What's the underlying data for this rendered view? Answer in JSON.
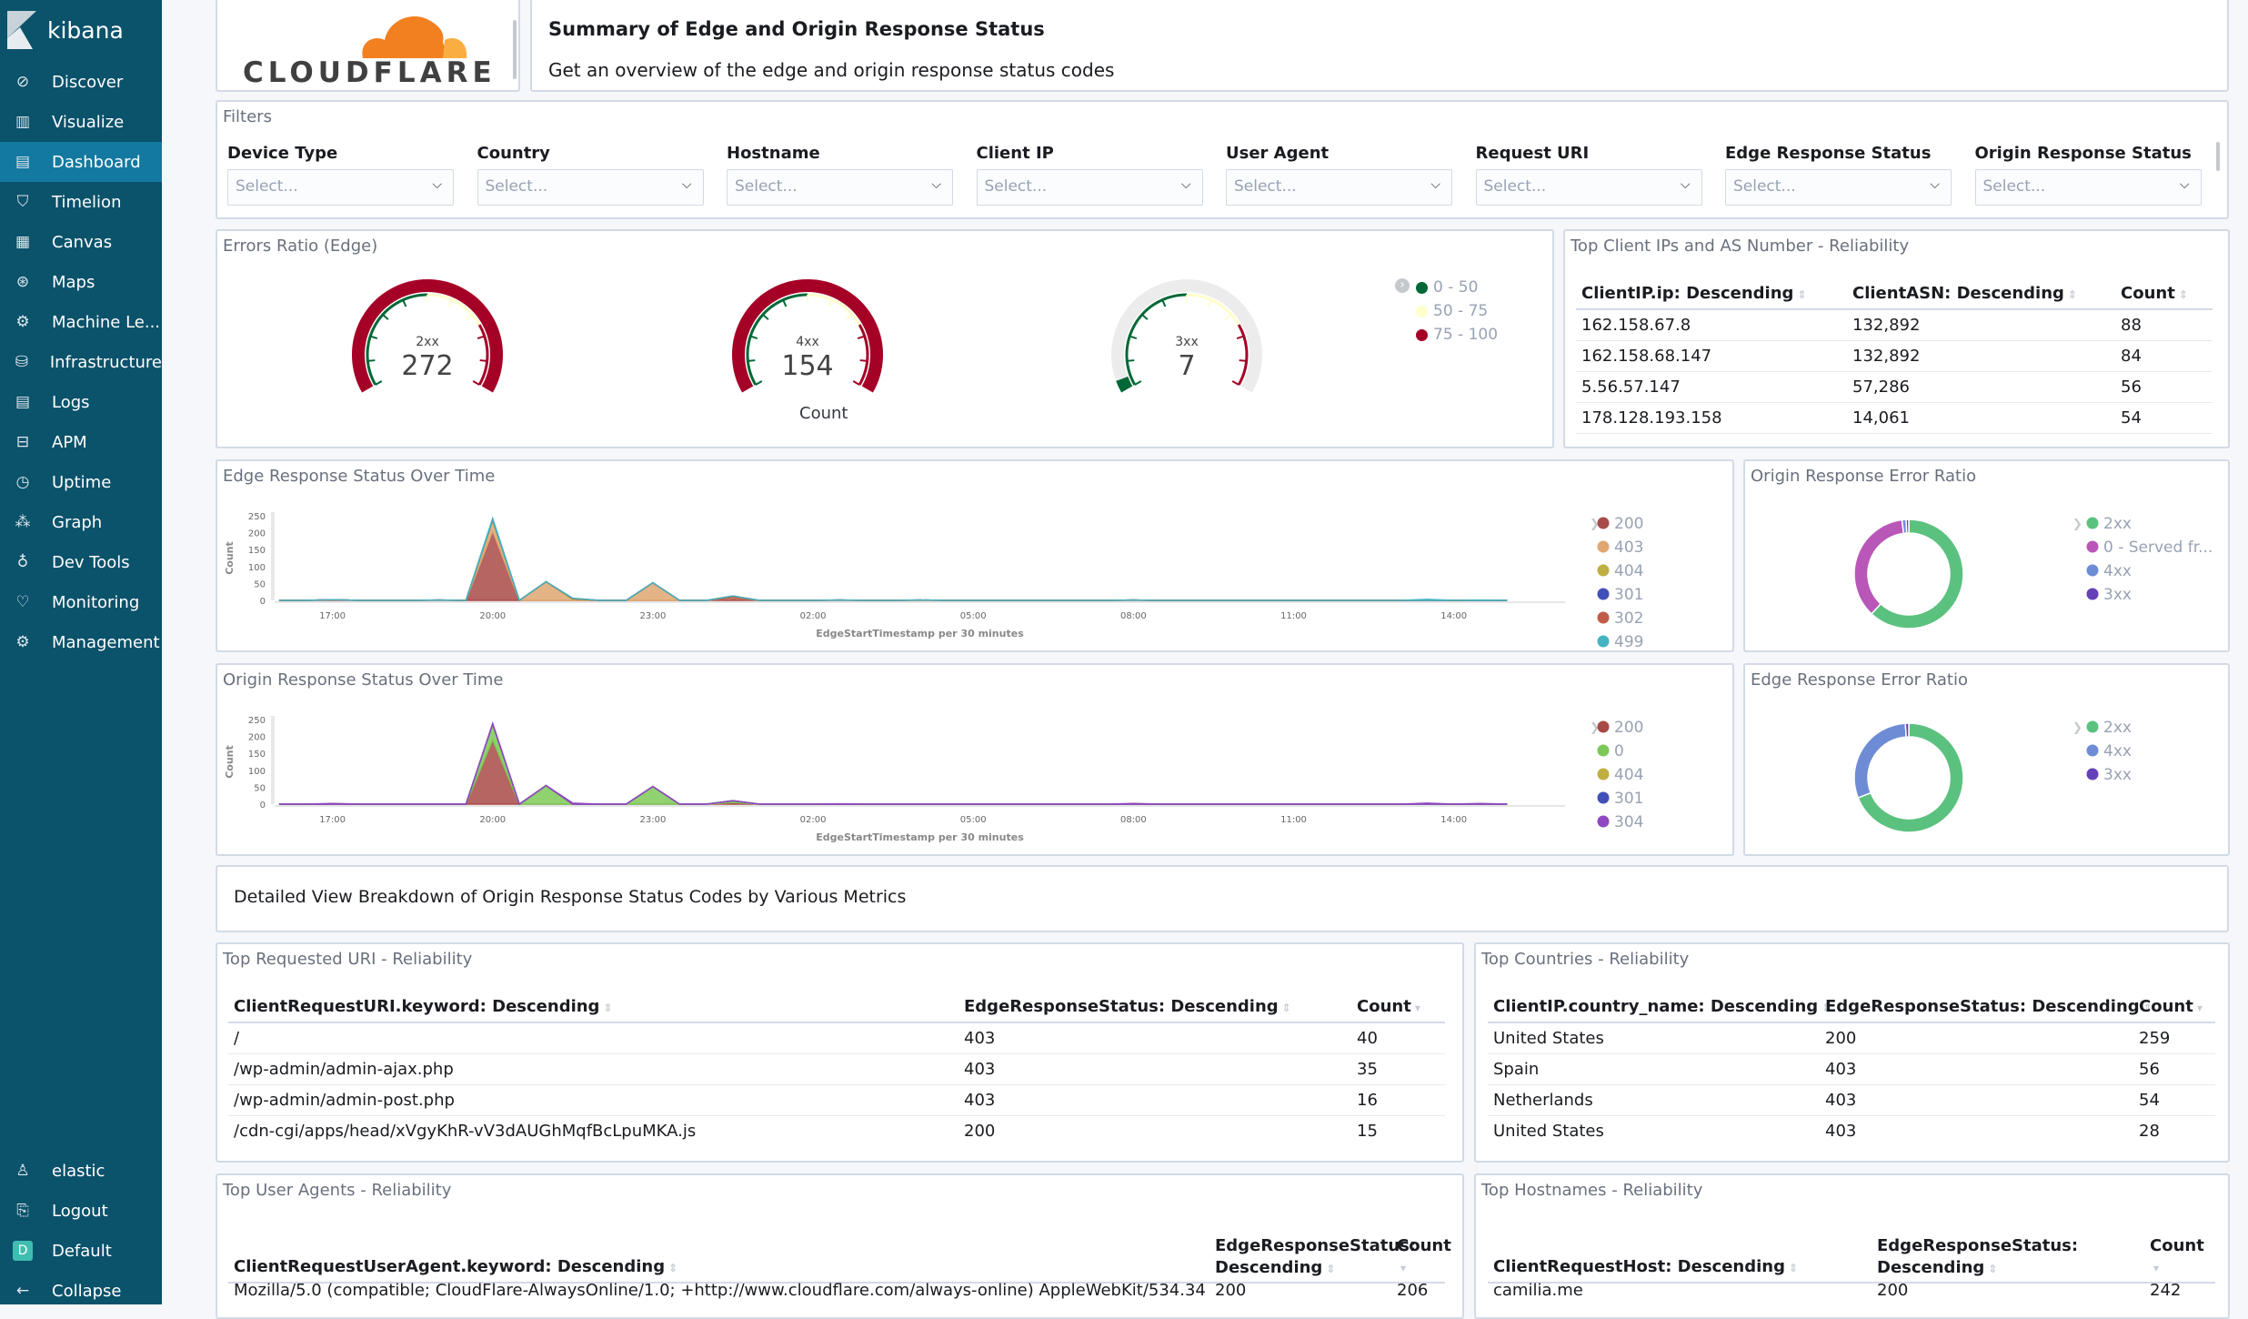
{
  "sidebar": {
    "brand": "kibana",
    "items": [
      {
        "label": "Discover",
        "icon": "compass-icon",
        "glyph": "⊘"
      },
      {
        "label": "Visualize",
        "icon": "visualize-icon",
        "glyph": "▥"
      },
      {
        "label": "Dashboard",
        "icon": "dashboard-icon",
        "glyph": "▤",
        "active": true
      },
      {
        "label": "Timelion",
        "icon": "timelion-icon",
        "glyph": "⛉"
      },
      {
        "label": "Canvas",
        "icon": "canvas-icon",
        "glyph": "▦"
      },
      {
        "label": "Maps",
        "icon": "maps-icon",
        "glyph": "⊛"
      },
      {
        "label": "Machine Le...",
        "icon": "machine-learning-icon",
        "glyph": "⚙"
      },
      {
        "label": "Infrastructure",
        "icon": "infrastructure-icon",
        "glyph": "⛁"
      },
      {
        "label": "Logs",
        "icon": "logs-icon",
        "glyph": "▤"
      },
      {
        "label": "APM",
        "icon": "apm-icon",
        "glyph": "⊟"
      },
      {
        "label": "Uptime",
        "icon": "uptime-icon",
        "glyph": "◷"
      },
      {
        "label": "Graph",
        "icon": "graph-icon",
        "glyph": "⁂"
      },
      {
        "label": "Dev Tools",
        "icon": "dev-tools-icon",
        "glyph": "♁"
      },
      {
        "label": "Monitoring",
        "icon": "monitoring-icon",
        "glyph": "♡"
      },
      {
        "label": "Management",
        "icon": "gear-icon",
        "glyph": "⚙"
      }
    ],
    "bottom": [
      {
        "label": "elastic",
        "icon": "user-icon",
        "glyph": "♙"
      },
      {
        "label": "Logout",
        "icon": "logout-icon",
        "glyph": "⎘"
      },
      {
        "label": "Default",
        "icon": "space-icon",
        "glyph": "D"
      },
      {
        "label": "Collapse",
        "icon": "collapse-icon",
        "glyph": "←"
      }
    ]
  },
  "header": {
    "logo_text": "CLOUDFLARE",
    "title": "Summary of Edge and Origin Response Status",
    "subtitle": "Get an overview of the edge and origin response status codes"
  },
  "filters": {
    "title": "Filters",
    "placeholder": "Select...",
    "controls": [
      "Device Type",
      "Country",
      "Hostname",
      "Client IP",
      "User Agent",
      "Request URI",
      "Edge Response Status",
      "Origin Response Status"
    ]
  },
  "gauges": {
    "title": "Errors Ratio (Edge)",
    "metric_label": "Count",
    "items": [
      {
        "label": "2xx",
        "value": "272",
        "fill_percent": 100
      },
      {
        "label": "4xx",
        "value": "154",
        "fill_percent": 100
      },
      {
        "label": "3xx",
        "value": "7",
        "fill_percent": 4
      }
    ],
    "ranges": [
      {
        "label": "0 - 50",
        "color": "#006837"
      },
      {
        "label": "50 - 75",
        "color": "#ffffcc"
      },
      {
        "label": "75 - 100",
        "color": "#a50026"
      }
    ]
  },
  "client_ips": {
    "title": "Top Client IPs and AS Number - Reliability",
    "columns": [
      "ClientIP.ip: Descending",
      "ClientASN: Descending",
      "Count"
    ],
    "rows": [
      [
        "162.158.67.8",
        "132,892",
        "88"
      ],
      [
        "162.158.68.147",
        "132,892",
        "84"
      ],
      [
        "5.56.57.147",
        "57,286",
        "56"
      ],
      [
        "178.128.193.158",
        "14,061",
        "54"
      ]
    ]
  },
  "chart_data": [
    {
      "type": "area",
      "title": "Edge Response Status Over Time",
      "xlabel": "EdgeStartTimestamp per 30 minutes",
      "ylabel": "Count",
      "ylim": [
        0,
        250
      ],
      "yticks": [
        "0",
        "50",
        "100",
        "150",
        "200",
        "250"
      ],
      "xticks": [
        "17:00",
        "20:00",
        "23:00",
        "02:00",
        "05:00",
        "08:00",
        "11:00",
        "14:00"
      ],
      "stacked": true,
      "legend": "right",
      "series": [
        {
          "name": "200",
          "color": "#a84a47",
          "points": [
            [
              "17:00",
              2
            ],
            [
              "19:00",
              1
            ],
            [
              "20:00",
              205
            ],
            [
              "00:30",
              7
            ],
            [
              "02:30",
              1
            ],
            [
              "08:00",
              1
            ]
          ]
        },
        {
          "name": "403",
          "color": "#e0a771",
          "points": [
            [
              "20:00",
              30
            ],
            [
              "21:00",
              55
            ],
            [
              "21:30",
              3
            ],
            [
              "23:00",
              52
            ],
            [
              "00:30",
              2
            ],
            [
              "04:00",
              1
            ]
          ]
        },
        {
          "name": "404",
          "color": "#bfaf40",
          "points": [
            [
              "20:00",
              3
            ],
            [
              "21:30",
              2
            ]
          ]
        },
        {
          "name": "301",
          "color": "#4150b8",
          "points": [
            [
              "20:00",
              2
            ]
          ]
        },
        {
          "name": "302",
          "color": "#c15c48",
          "points": [
            [
              "21:30",
              1
            ],
            [
              "00:30",
              4
            ]
          ]
        },
        {
          "name": "499",
          "color": "#44b4c0",
          "points": [
            [
              "20:00",
              2
            ],
            [
              "13:30",
              3
            ],
            [
              "14:30",
              1
            ]
          ]
        }
      ]
    },
    {
      "type": "area",
      "title": "Origin Response Status Over Time",
      "xlabel": "EdgeStartTimestamp per 30 minutes",
      "ylabel": "Count",
      "ylim": [
        0,
        250
      ],
      "yticks": [
        "0",
        "50",
        "100",
        "150",
        "200",
        "250"
      ],
      "xticks": [
        "17:00",
        "20:00",
        "23:00",
        "02:00",
        "05:00",
        "08:00",
        "11:00",
        "14:00"
      ],
      "stacked": true,
      "legend": "right",
      "series": [
        {
          "name": "200",
          "color": "#a84a47",
          "points": [
            [
              "20:00",
              190
            ],
            [
              "00:30",
              5
            ]
          ]
        },
        {
          "name": "0",
          "color": "#7cc957",
          "points": [
            [
              "20:00",
              45
            ],
            [
              "21:00",
              55
            ],
            [
              "23:00",
              52
            ],
            [
              "00:30",
              5
            ]
          ]
        },
        {
          "name": "404",
          "color": "#bfaf40",
          "points": [
            [
              "20:00",
              2
            ]
          ]
        },
        {
          "name": "301",
          "color": "#4150b8",
          "points": [
            [
              "20:00",
              1
            ]
          ]
        },
        {
          "name": "304",
          "color": "#9147c2",
          "points": [
            [
              "17:00",
              2
            ],
            [
              "21:30",
              3
            ],
            [
              "02:30",
              1
            ],
            [
              "08:00",
              2
            ],
            [
              "13:30",
              3
            ],
            [
              "14:30",
              2
            ]
          ]
        }
      ]
    },
    {
      "type": "pie",
      "title": "Origin Response Error Ratio",
      "donut": true,
      "legend": "right",
      "slices": [
        {
          "name": "2xx",
          "value": 62,
          "color": "#5bc17f"
        },
        {
          "name": "0 - Served fr...",
          "value": 36,
          "color": "#b957b9"
        },
        {
          "name": "4xx",
          "value": 1.2,
          "color": "#6e8bd6"
        },
        {
          "name": "3xx",
          "value": 0.8,
          "color": "#6540b8"
        }
      ]
    },
    {
      "type": "pie",
      "title": "Edge Response Error Ratio",
      "donut": true,
      "legend": "right",
      "slices": [
        {
          "name": "2xx",
          "value": 69,
          "color": "#5bc17f"
        },
        {
          "name": "4xx",
          "value": 30,
          "color": "#6e8bd6"
        },
        {
          "name": "3xx",
          "value": 1,
          "color": "#6540b8"
        }
      ]
    }
  ],
  "detail_heading": "Detailed View Breakdown of Origin Response Status Codes by Various Metrics",
  "uri_table": {
    "title": "Top Requested URI - Reliability",
    "columns": [
      "ClientRequestURI.keyword: Descending",
      "EdgeResponseStatus: Descending",
      "Count"
    ],
    "rows": [
      [
        "/",
        "403",
        "40"
      ],
      [
        "/wp-admin/admin-ajax.php",
        "403",
        "35"
      ],
      [
        "/wp-admin/admin-post.php",
        "403",
        "16"
      ],
      [
        "/cdn-cgi/apps/head/xVgyKhR-vV3dAUGhMqfBcLpuMKA.js",
        "200",
        "15"
      ]
    ]
  },
  "country_table": {
    "title": "Top Countries - Reliability",
    "columns": [
      "ClientIP.country_name: Descending",
      "EdgeResponseStatus: Descending",
      "Count"
    ],
    "rows": [
      [
        "United States",
        "200",
        "259"
      ],
      [
        "Spain",
        "403",
        "56"
      ],
      [
        "Netherlands",
        "403",
        "54"
      ],
      [
        "United States",
        "403",
        "28"
      ]
    ]
  },
  "ua_table": {
    "title": "Top User Agents - Reliability",
    "columns": [
      "ClientRequestUserAgent.keyword: Descending",
      "EdgeResponseStatus:",
      "Descending",
      "Count"
    ],
    "rows": [
      [
        "Mozilla/5.0 (compatible; CloudFlare-AlwaysOnline/1.0; +http://www.cloudflare.com/always-online) AppleWebKit/534.34",
        "200",
        "206"
      ]
    ]
  },
  "host_table": {
    "title": "Top Hostnames - Reliability",
    "columns": [
      "ClientRequestHost: Descending",
      "EdgeResponseStatus:",
      "Descending",
      "Count"
    ],
    "rows": [
      [
        "camilia.me",
        "200",
        "242"
      ]
    ]
  }
}
